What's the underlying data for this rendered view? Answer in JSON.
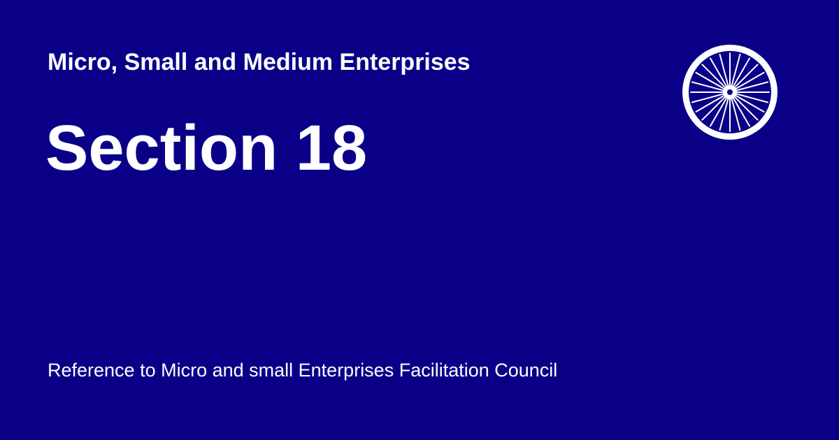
{
  "card": {
    "subtitle": "Micro, Small and Medium Enterprises",
    "title": "Section 18",
    "description": "Reference to Micro and small Enterprises Facilitation Council"
  },
  "emblem": {
    "icon": "ashoka-chakra-icon",
    "spoke_count": 24
  },
  "colors": {
    "background": "#0a0088",
    "text": "#ffffff",
    "emblem_fill": "#0a0088",
    "emblem_stroke": "#ffffff"
  }
}
